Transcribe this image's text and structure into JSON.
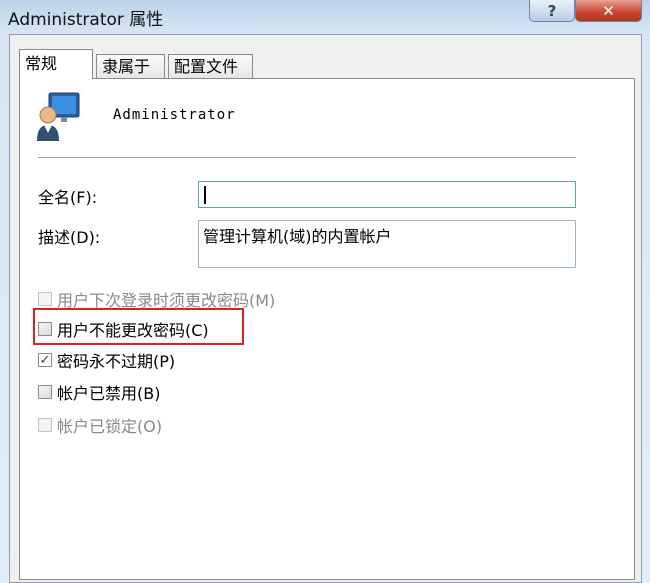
{
  "window": {
    "title": "Administrator 属性",
    "help_label": "?",
    "close_label": "✕"
  },
  "tabs": [
    {
      "label": "常规",
      "active": true
    },
    {
      "label": "隶属于",
      "active": false
    },
    {
      "label": "配置文件",
      "active": false
    }
  ],
  "account": {
    "name": "Administrator"
  },
  "fields": {
    "full_name": {
      "label": "全名(F):",
      "value": ""
    },
    "description": {
      "label": "描述(D):",
      "value": "管理计算机(域)的内置帐户"
    }
  },
  "checkboxes": [
    {
      "label": "用户下次登录时须更改密码(M)",
      "checked": false,
      "enabled": false
    },
    {
      "label": "用户不能更改密码(C)",
      "checked": false,
      "enabled": true,
      "highlighted": true
    },
    {
      "label": "密码永不过期(P)",
      "checked": true,
      "enabled": true
    },
    {
      "label": "帐户已禁用(B)",
      "checked": false,
      "enabled": true
    },
    {
      "label": "帐户已锁定(O)",
      "checked": false,
      "enabled": false
    }
  ],
  "colors": {
    "highlight": "#e02020",
    "check": "#1f3f9f"
  }
}
